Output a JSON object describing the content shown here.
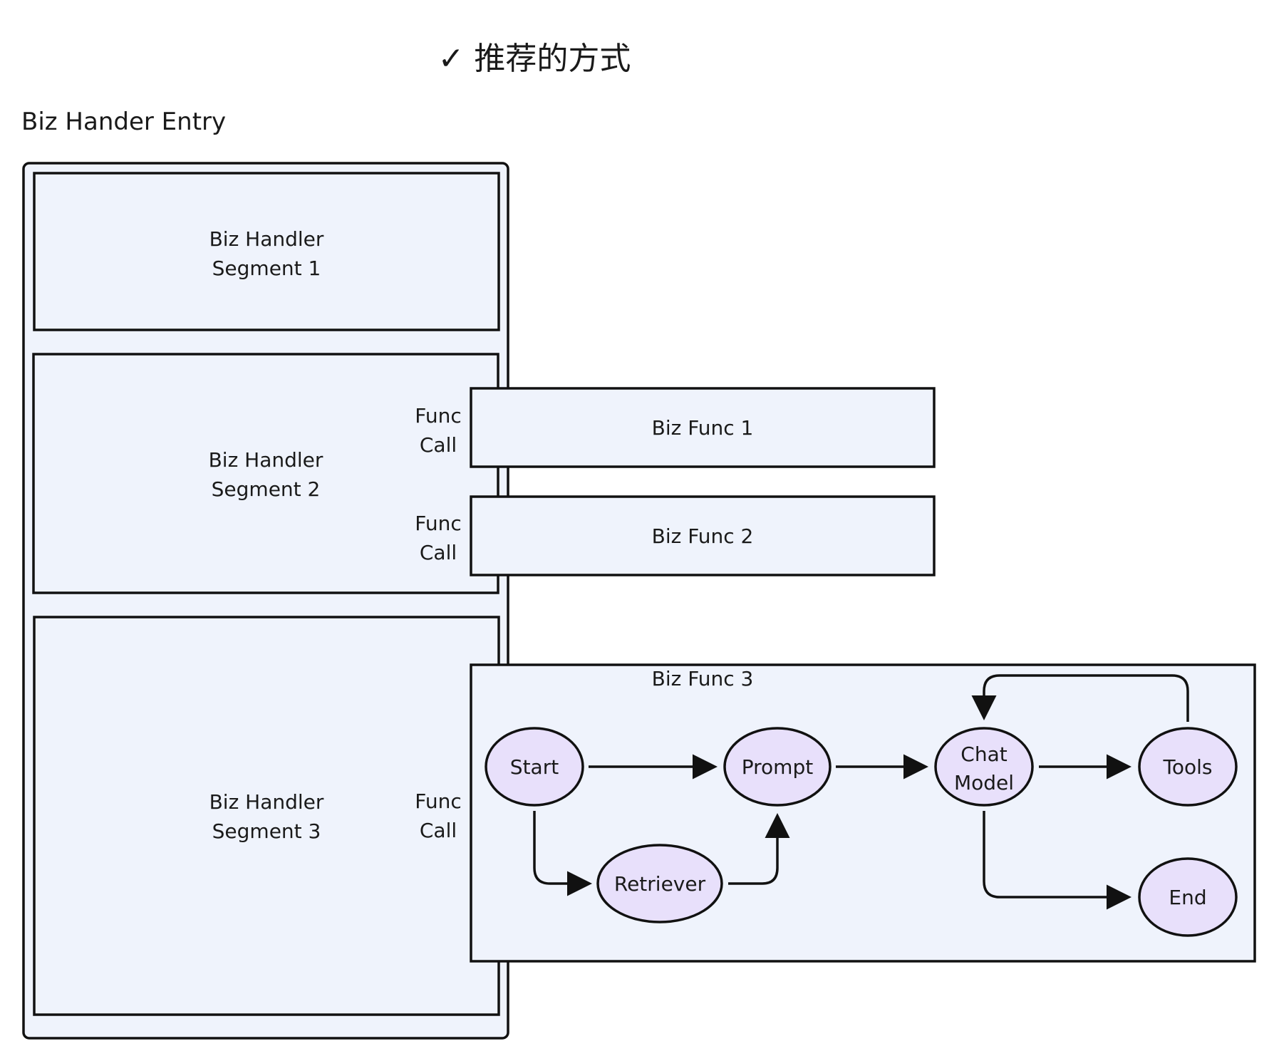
{
  "title": "✓ 推荐的方式",
  "entry_label": "Biz Hander Entry",
  "segments": [
    {
      "line1": "Biz  Handler",
      "line2": "Segment 1"
    },
    {
      "line1": "Biz  Handler",
      "line2": "Segment 2"
    },
    {
      "line1": "Biz Handler",
      "line2": "Segment 3"
    }
  ],
  "func_calls": [
    {
      "line1": "Func",
      "line2": "Call"
    },
    {
      "line1": "Func",
      "line2": "Call"
    },
    {
      "line1": "Func",
      "line2": "Call"
    }
  ],
  "funcs": {
    "func1": "Biz  Func 1",
    "func2": "Biz  Func 2",
    "func3": "Biz  Func 3"
  },
  "nodes": {
    "start": "Start",
    "prompt": "Prompt",
    "chat_model_line1": "Chat",
    "chat_model_line2": "Model",
    "tools": "Tools",
    "retriever": "Retriever",
    "end": "End"
  },
  "colors": {
    "box_fill": "#eff3fc",
    "node_fill": "#e8e0fb",
    "stroke": "#111111"
  }
}
